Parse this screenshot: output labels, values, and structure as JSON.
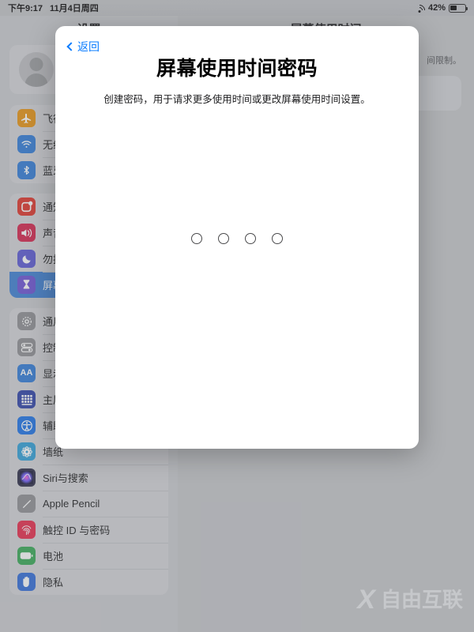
{
  "status_bar": {
    "time": "下午9:17",
    "date": "11月4日周四",
    "wifi_icon": "wifi-icon",
    "battery_percent": "42%",
    "battery_icon": "battery-icon",
    "battery_level": 42
  },
  "sidebar": {
    "title": "设置",
    "account": {
      "avatar_icon": "avatar-placeholder-icon"
    },
    "groups": [
      {
        "items": [
          {
            "label": "飞行模式",
            "icon": "airplane-icon",
            "color": "#e8920f",
            "glyph": "✈",
            "selected": false
          },
          {
            "label": "无线局域网",
            "icon": "wifi-icon",
            "color": "#2f7ad8",
            "glyph": "",
            "selected": false
          },
          {
            "label": "蓝牙",
            "icon": "bluetooth-icon",
            "color": "#2f7ad8",
            "glyph": "",
            "selected": false
          }
        ]
      },
      {
        "items": [
          {
            "label": "通知",
            "icon": "notifications-icon",
            "color": "#e03127",
            "glyph": "",
            "selected": false
          },
          {
            "label": "声音",
            "icon": "sounds-icon",
            "color": "#d6204a",
            "glyph": "",
            "selected": false
          },
          {
            "label": "勿扰模式",
            "icon": "do-not-disturb-icon",
            "color": "#5a57d4",
            "glyph": "",
            "selected": false
          },
          {
            "label": "屏幕使用时间",
            "icon": "screen-time-icon",
            "color": "#6a4fd6",
            "glyph": "",
            "selected": true
          }
        ]
      },
      {
        "items": [
          {
            "label": "通用",
            "icon": "general-gear-icon",
            "color": "#8e8e93",
            "glyph": "",
            "selected": false
          },
          {
            "label": "控制中心",
            "icon": "control-center-icon",
            "color": "#8e8e93",
            "glyph": "",
            "selected": false
          },
          {
            "label": "显示与亮度",
            "icon": "display-brightness-icon",
            "color": "#2f7ad8",
            "glyph": "AA",
            "selected": false
          },
          {
            "label": "主屏幕与程序坞",
            "icon": "home-screen-dock-icon",
            "color": "#2b3fa8",
            "glyph": "",
            "selected": false
          },
          {
            "label": "辅助功能",
            "icon": "accessibility-icon",
            "color": "#1b72e8",
            "glyph": "",
            "selected": false
          },
          {
            "label": "墙纸",
            "icon": "wallpaper-icon",
            "color": "#2f9fd8",
            "glyph": "",
            "selected": false
          },
          {
            "label": "Siri与搜索",
            "icon": "siri-icon",
            "color": "#2a2a46",
            "glyph": "",
            "selected": false
          },
          {
            "label": "Apple Pencil",
            "icon": "apple-pencil-icon",
            "color": "#8e8e93",
            "glyph": "",
            "selected": false
          },
          {
            "label": "触控 ID 与密码",
            "icon": "touch-id-icon",
            "color": "#e8294a",
            "glyph": "",
            "selected": false
          },
          {
            "label": "电池",
            "icon": "battery-icon",
            "color": "#34a853",
            "glyph": "",
            "selected": false
          },
          {
            "label": "隐私",
            "icon": "privacy-hand-icon",
            "color": "#2f6ad8",
            "glyph": "✋",
            "selected": false
          }
        ]
      }
    ]
  },
  "detail_panel": {
    "title": "屏幕使用时间",
    "blurb_fragment": "间限制。"
  },
  "modal": {
    "back_label": "返回",
    "back_icon": "chevron-left-icon",
    "title": "屏幕使用时间密码",
    "subtitle": "创建密码，用于请求更多使用时间或更改屏幕使用时间设置。",
    "passcode": {
      "length": 4,
      "entered": 0
    }
  },
  "watermark": {
    "logo": "X",
    "text": "自由互联"
  },
  "colors": {
    "accent_blue": "#0a7cff",
    "selected_row": "#3b7fd4",
    "sidebar_bg": "#cbccd0",
    "card_bg": "#d4d5d9"
  }
}
